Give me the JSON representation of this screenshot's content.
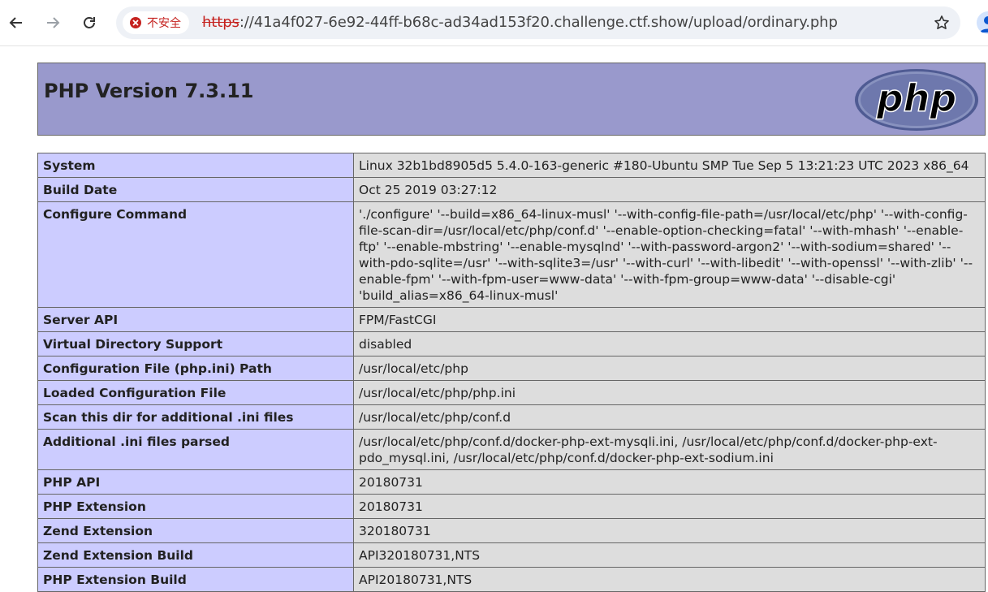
{
  "browser": {
    "security_label": "不安全",
    "url_scheme": "https",
    "url_rest": "://41a4f027-6e92-44ff-b68c-ad34ad153f20.challenge.ctf.show/upload/ordinary.php",
    "icons": [
      "back-arrow-icon",
      "forward-arrow-icon",
      "reload-icon",
      "warning-icon",
      "star-icon",
      "profile-avatar"
    ]
  },
  "php": {
    "title": "PHP Version 7.3.11",
    "logo_text": "php",
    "rows": [
      {
        "key": "System",
        "value": "Linux 32b1bd8905d5 5.4.0-163-generic #180-Ubuntu SMP Tue Sep 5 13:21:23 UTC 2023 x86_64"
      },
      {
        "key": "Build Date",
        "value": "Oct 25 2019 03:27:12"
      },
      {
        "key": "Configure Command",
        "value": "'./configure' '--build=x86_64-linux-musl' '--with-config-file-path=/usr/local/etc/php' '--with-config-file-scan-dir=/usr/local/etc/php/conf.d' '--enable-option-checking=fatal' '--with-mhash' '--enable-ftp' '--enable-mbstring' '--enable-mysqlnd' '--with-password-argon2' '--with-sodium=shared' '--with-pdo-sqlite=/usr' '--with-sqlite3=/usr' '--with-curl' '--with-libedit' '--with-openssl' '--with-zlib' '--enable-fpm' '--with-fpm-user=www-data' '--with-fpm-group=www-data' '--disable-cgi' 'build_alias=x86_64-linux-musl'"
      },
      {
        "key": "Server API",
        "value": "FPM/FastCGI"
      },
      {
        "key": "Virtual Directory Support",
        "value": "disabled"
      },
      {
        "key": "Configuration File (php.ini) Path",
        "value": "/usr/local/etc/php"
      },
      {
        "key": "Loaded Configuration File",
        "value": "/usr/local/etc/php/php.ini"
      },
      {
        "key": "Scan this dir for additional .ini files",
        "value": "/usr/local/etc/php/conf.d"
      },
      {
        "key": "Additional .ini files parsed",
        "value": "/usr/local/etc/php/conf.d/docker-php-ext-mysqli.ini, /usr/local/etc/php/conf.d/docker-php-ext-pdo_mysql.ini, /usr/local/etc/php/conf.d/docker-php-ext-sodium.ini"
      },
      {
        "key": "PHP API",
        "value": "20180731"
      },
      {
        "key": "PHP Extension",
        "value": "20180731"
      },
      {
        "key": "Zend Extension",
        "value": "320180731"
      },
      {
        "key": "Zend Extension Build",
        "value": "API320180731,NTS"
      },
      {
        "key": "PHP Extension Build",
        "value": "API20180731,NTS"
      }
    ]
  },
  "colors": {
    "header_bg": "#9999cc",
    "key_bg": "#ccccff",
    "value_bg": "#dddddd",
    "insecure_red": "#c5221f"
  }
}
